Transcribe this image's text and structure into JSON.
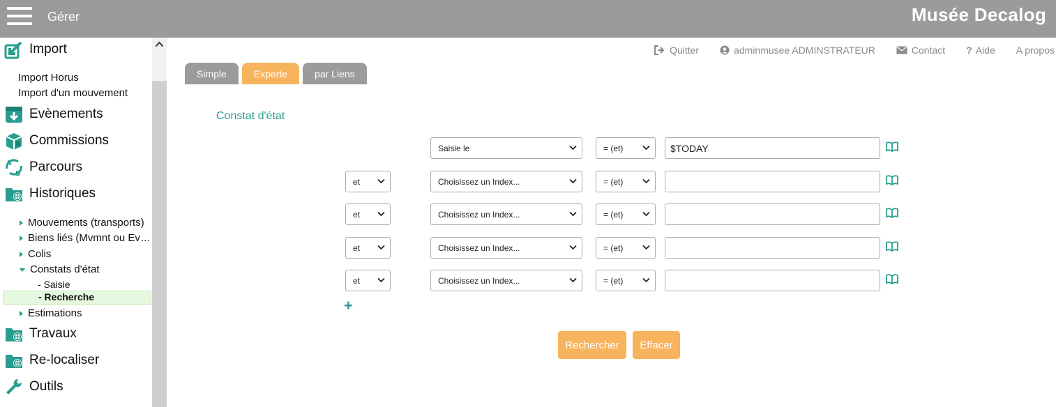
{
  "header": {
    "menu_label": "Gérer",
    "brand": "Musée Decalog"
  },
  "sidebar": {
    "import": {
      "label": "Import",
      "items": [
        "Import Horus",
        "Import d'un mouvement"
      ]
    },
    "sections": [
      "Evènements",
      "Commissions",
      "Parcours",
      "Historiques"
    ],
    "tree": [
      {
        "label": "Mouvements (transports)"
      },
      {
        "label": "Biens liés (Mvmnt ou Ev…"
      },
      {
        "label": "Colis"
      },
      {
        "label": "Constats d'état"
      }
    ],
    "leaves": [
      "- Saisie",
      "- Recherche"
    ],
    "tree_after": {
      "label": "Estimations"
    },
    "sections_after": [
      "Travaux",
      "Re-localiser",
      "Outils"
    ]
  },
  "toplinks": {
    "quit": "Quitter",
    "user": "adminmusee ADMINSTRATEUR",
    "contact": "Contact",
    "help": "Aide",
    "about": "A propos"
  },
  "tabs": [
    "Simple",
    "Experte",
    "par Liens"
  ],
  "section_title": "Constat d'état",
  "rows": [
    {
      "logic": "",
      "index": "Saisie le",
      "op": "= (et)",
      "value": "$TODAY"
    },
    {
      "logic": "et",
      "index": "Choisissez un Index...",
      "op": "= (et)",
      "value": ""
    },
    {
      "logic": "et",
      "index": "Choisissez un Index...",
      "op": "= (et)",
      "value": ""
    },
    {
      "logic": "et",
      "index": "Choisissez un Index...",
      "op": "= (et)",
      "value": ""
    },
    {
      "logic": "et",
      "index": "Choisissez un Index...",
      "op": "= (et)",
      "value": ""
    }
  ],
  "add_symbol": "+",
  "buttons": {
    "search": "Rechercher",
    "clear": "Effacer"
  },
  "colors": {
    "accent": "#f8b35d",
    "teal": "#2a9d8f",
    "topbar": "#9b9b9b"
  },
  "icons": [
    "menu-icon",
    "import-icon",
    "events-icon",
    "commissions-icon",
    "parcours-icon",
    "historiques-icon",
    "travaux-icon",
    "relocaliser-icon",
    "outils-icon",
    "signout-icon",
    "user-icon",
    "envelope-icon",
    "question-icon",
    "book-icon"
  ]
}
